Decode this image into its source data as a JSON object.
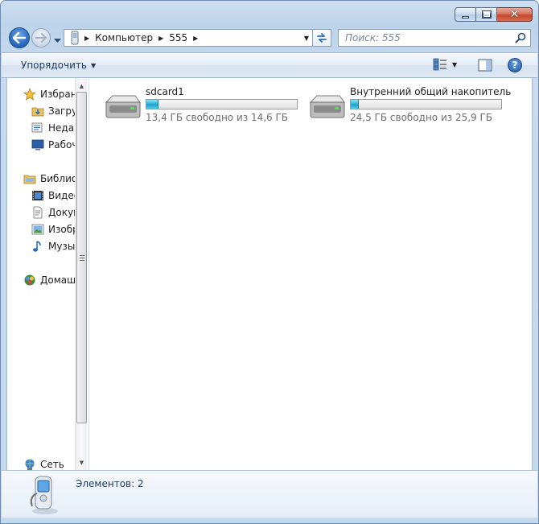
{
  "window": {
    "caption_buttons": [
      "minimize",
      "maximize",
      "close"
    ]
  },
  "address": {
    "crumbs": [
      "Компьютер",
      "555"
    ]
  },
  "search": {
    "placeholder": "Поиск: 555"
  },
  "toolbar": {
    "organize_label": "Упорядочить"
  },
  "sidebar": {
    "items": [
      {
        "label": "Избранное",
        "icon": "star-icon"
      },
      {
        "label": "Загрузки",
        "icon": "downloads-folder-icon"
      },
      {
        "label": "Недавние места",
        "icon": "recent-places-icon"
      },
      {
        "label": "Рабочий стол",
        "icon": "desktop-icon"
      },
      {
        "label": "Библиотеки",
        "icon": "libraries-icon"
      },
      {
        "label": "Видео",
        "icon": "video-library-icon"
      },
      {
        "label": "Документы",
        "icon": "documents-library-icon"
      },
      {
        "label": "Изображения",
        "icon": "pictures-library-icon"
      },
      {
        "label": "Музыка",
        "icon": "music-library-icon"
      },
      {
        "label": "Домашняя группа",
        "icon": "homegroup-icon"
      },
      {
        "label": "Сеть",
        "icon": "network-icon"
      }
    ]
  },
  "drives": [
    {
      "name": "sdcard1",
      "free_text": "13,4 ГБ свободно из 14,6 ГБ",
      "used_fraction": 0.08
    },
    {
      "name": "Внутренний общий накопитель",
      "free_text": "24,5 ГБ свободно из 25,9 ГБ",
      "used_fraction": 0.054
    }
  ],
  "details": {
    "items_count": "Элементов: 2"
  },
  "colors": {
    "frame": "#c4d8ee",
    "drive_fill": "#26b3d8",
    "toolbar_text": "#1e395b"
  }
}
